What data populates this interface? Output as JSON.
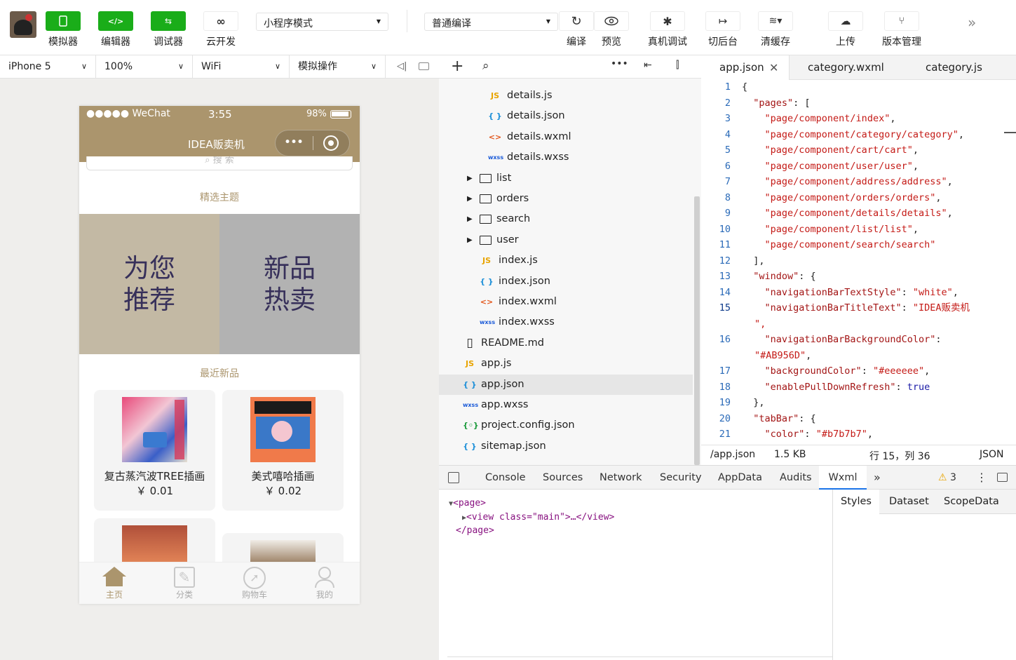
{
  "toolbar": {
    "simulator": "模拟器",
    "editor": "编辑器",
    "debugger": "调试器",
    "cloud": "云开发",
    "mode": "小程序模式",
    "compile_mode": "普通编译",
    "compile": "编译",
    "preview": "预览",
    "real_debug": "真机调试",
    "background": "切后台",
    "clear_cache": "清缓存",
    "upload": "上传",
    "version": "版本管理"
  },
  "subbar": {
    "device": "iPhone 5",
    "zoom": "100%",
    "network": "WiFi",
    "operation": "模拟操作"
  },
  "phone": {
    "status_signal": "●●●●● WeChat",
    "status_time": "3:55",
    "status_battery": "98%",
    "nav_title": "IDEA贩卖机",
    "search_placeholder": "搜 索",
    "section_theme": "精选主题",
    "theme_left": "为您\n推荐",
    "theme_right": "新品\n热卖",
    "section_new": "最近新品",
    "products": [
      {
        "name": "复古蒸汽波TREE插画",
        "price": "￥ 0.01"
      },
      {
        "name": "美式嘻哈插画",
        "price": "￥ 0.02"
      }
    ],
    "tabbar": [
      {
        "label": "主页"
      },
      {
        "label": "分类"
      },
      {
        "label": "购物车"
      },
      {
        "label": "我的"
      }
    ],
    "colors": {
      "nav": "#ab956d",
      "accent": "#ab956d"
    }
  },
  "tree": [
    {
      "name": "details.js",
      "type": "js"
    },
    {
      "name": "details.json",
      "type": "json"
    },
    {
      "name": "details.wxml",
      "type": "wxml"
    },
    {
      "name": "details.wxss",
      "type": "wxss"
    },
    {
      "name": "list",
      "type": "folder"
    },
    {
      "name": "orders",
      "type": "folder"
    },
    {
      "name": "search",
      "type": "folder"
    },
    {
      "name": "user",
      "type": "folder"
    },
    {
      "name": "index.js",
      "type": "js"
    },
    {
      "name": "index.json",
      "type": "json"
    },
    {
      "name": "index.wxml",
      "type": "wxml"
    },
    {
      "name": "index.wxss",
      "type": "wxss"
    },
    {
      "name": "README.md",
      "type": "md"
    },
    {
      "name": "app.js",
      "type": "js"
    },
    {
      "name": "app.json",
      "type": "json",
      "selected": true
    },
    {
      "name": "app.wxss",
      "type": "wxss"
    },
    {
      "name": "project.config.json",
      "type": "config"
    },
    {
      "name": "sitemap.json",
      "type": "json"
    }
  ],
  "editor": {
    "tabs": [
      "app.json",
      "category.wxml",
      "category.js"
    ],
    "lines": [
      {
        "n": "1",
        "t": "{"
      },
      {
        "n": "2",
        "t": "  \"pages\": ["
      },
      {
        "n": "3",
        "t": "    \"page/component/index\","
      },
      {
        "n": "4",
        "t": "    \"page/component/category/category\","
      },
      {
        "n": "5",
        "t": "    \"page/component/cart/cart\","
      },
      {
        "n": "6",
        "t": "    \"page/component/user/user\","
      },
      {
        "n": "7",
        "t": "    \"page/component/address/address\","
      },
      {
        "n": "8",
        "t": "    \"page/component/orders/orders\","
      },
      {
        "n": "9",
        "t": "    \"page/component/details/details\","
      },
      {
        "n": "10",
        "t": "    \"page/component/list/list\","
      },
      {
        "n": "11",
        "t": "    \"page/component/search/search\""
      },
      {
        "n": "12",
        "t": "  ],"
      },
      {
        "n": "13",
        "t": "  \"window\": {"
      },
      {
        "n": "14",
        "t": "    \"navigationBarTextStyle\": \"white\","
      },
      {
        "n": "15",
        "t": "    \"navigationBarTitleText\": \"IDEA贩卖机"
      },
      {
        "n": "",
        "t": "\","
      },
      {
        "n": "16",
        "t": "    \"navigationBarBackgroundColor\":"
      },
      {
        "n": "",
        "t": "\"#AB956D\","
      },
      {
        "n": "17",
        "t": "    \"backgroundColor\": \"#eeeeee\","
      },
      {
        "n": "18",
        "t": "    \"enablePullDownRefresh\": true"
      },
      {
        "n": "19",
        "t": "  },"
      },
      {
        "n": "20",
        "t": "  \"tabBar\": {"
      },
      {
        "n": "21",
        "t": "    \"color\": \"#b7b7b7\","
      }
    ],
    "status": {
      "path": "/app.json",
      "size": "1.5 KB",
      "position": "行 15，列 36",
      "lang": "JSON"
    }
  },
  "devtools": {
    "tabs": [
      "Console",
      "Sources",
      "Network",
      "Security",
      "AppData",
      "Audits",
      "Wxml"
    ],
    "active": "Wxml",
    "warnings": "3",
    "dom": [
      "<page>",
      "<view  class=\"main\">…</view>",
      "</page>"
    ],
    "side_tabs": [
      "Styles",
      "Dataset",
      "ScopeData"
    ]
  }
}
